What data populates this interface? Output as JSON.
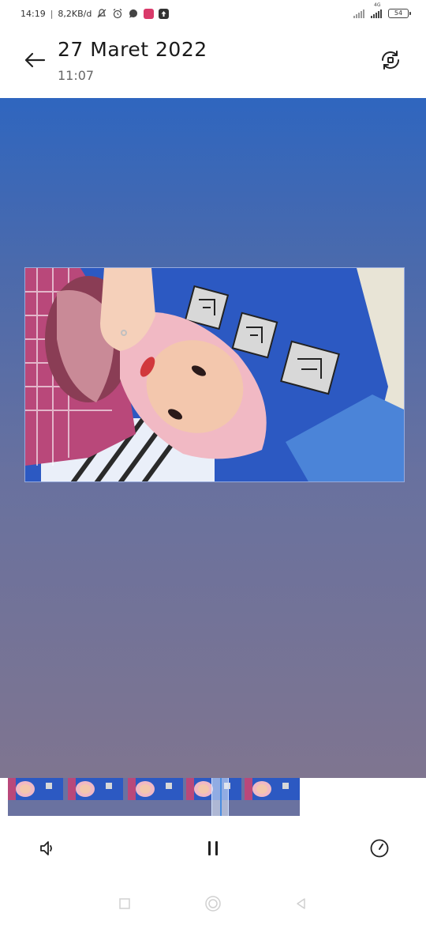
{
  "status_bar": {
    "time": "14:19",
    "separator": "|",
    "speed": "8,2KB/d",
    "network_label": "4G",
    "battery": "54"
  },
  "header": {
    "title": "27 Maret 2022",
    "subtitle": "11:07"
  },
  "icons": {
    "back": "arrow-left-icon",
    "rotate": "rotate-icon",
    "volume": "speaker-icon",
    "pause": "pause-icon",
    "speed": "gauge-icon",
    "nav_recent": "square-icon",
    "nav_home": "circle-icon",
    "nav_back": "triangle-icon"
  },
  "colors": {
    "stage_top": "#2f66bf",
    "stage_bottom": "#7f7590",
    "filmstrip_bg": "#6a72a0",
    "playhead_line": "#4a8de0"
  }
}
